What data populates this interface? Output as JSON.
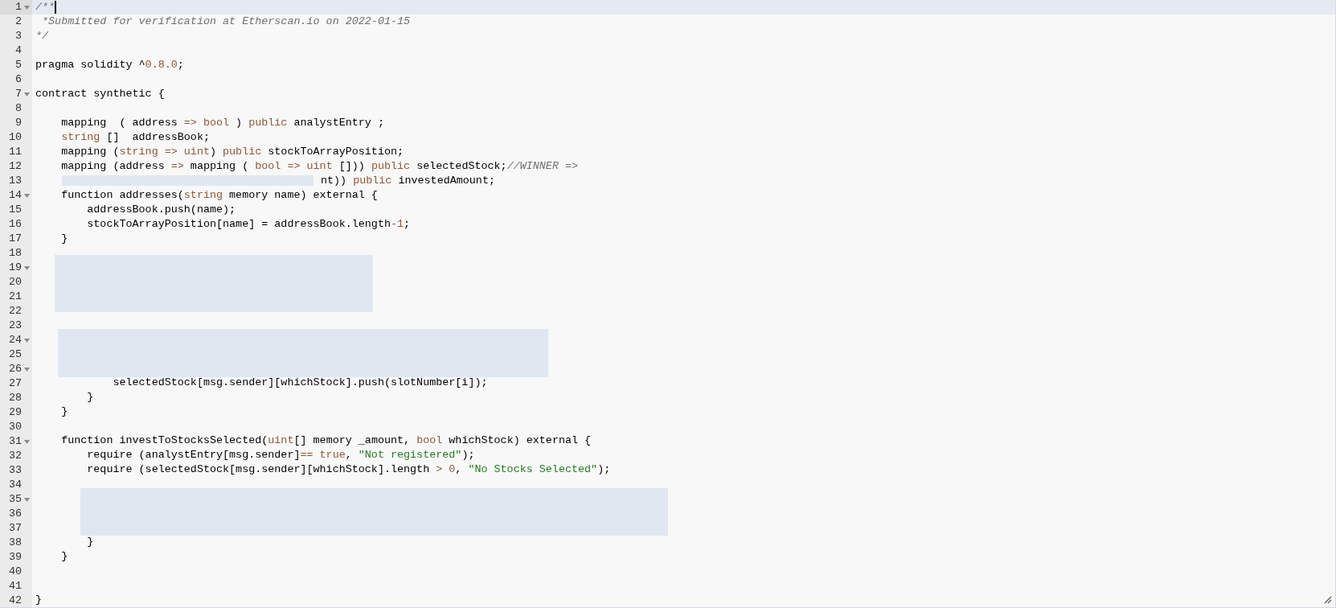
{
  "editor": {
    "lines": [
      {
        "number": "1",
        "kind": "code",
        "fold": true,
        "selected": true,
        "tokens": [
          {
            "kind": "comment",
            "text": "/**"
          }
        ]
      },
      {
        "number": "2",
        "kind": "code",
        "fold": false,
        "selected": false,
        "tokens": [
          {
            "kind": "comment",
            "text": " *Submitted for verification at Etherscan.io on 2022-01-15"
          }
        ]
      },
      {
        "number": "3",
        "kind": "code",
        "fold": false,
        "selected": false,
        "tokens": [
          {
            "kind": "comment",
            "text": "*/"
          }
        ]
      },
      {
        "number": "4",
        "kind": "code",
        "fold": false,
        "selected": false
      },
      {
        "number": "5",
        "kind": "code",
        "fold": false,
        "selected": false,
        "tokens": [
          {
            "kind": "plain",
            "text": "pragma solidity ^"
          },
          {
            "kind": "number",
            "text": "0.8.0"
          },
          {
            "kind": "plain",
            "text": ";"
          }
        ]
      },
      {
        "number": "6",
        "kind": "code",
        "fold": false,
        "selected": false
      },
      {
        "number": "7",
        "kind": "code",
        "fold": true,
        "selected": false,
        "tokens": [
          {
            "kind": "plain",
            "text": "contract synthetic {"
          }
        ]
      },
      {
        "number": "8",
        "kind": "code",
        "fold": false,
        "selected": false
      },
      {
        "number": "9",
        "kind": "code",
        "fold": false,
        "selected": false,
        "tokens": [
          {
            "kind": "plain",
            "text": "    mapping  ( address "
          },
          {
            "kind": "keyword",
            "text": "=> bool"
          },
          {
            "kind": "plain",
            "text": " ) "
          },
          {
            "kind": "keyword",
            "text": "public"
          },
          {
            "kind": "plain",
            "text": " analystEntry ;"
          }
        ]
      },
      {
        "number": "10",
        "kind": "code",
        "fold": false,
        "selected": false,
        "tokens": [
          {
            "kind": "keyword",
            "text": "    string"
          },
          {
            "kind": "plain",
            "text": " []  addressBook;"
          }
        ]
      },
      {
        "number": "11",
        "kind": "code",
        "fold": false,
        "selected": false,
        "tokens": [
          {
            "kind": "plain",
            "text": "    mapping ("
          },
          {
            "kind": "keyword",
            "text": "string => uint"
          },
          {
            "kind": "plain",
            "text": ") "
          },
          {
            "kind": "keyword",
            "text": "public"
          },
          {
            "kind": "plain",
            "text": " stockToArrayPosition;"
          }
        ]
      },
      {
        "number": "12",
        "kind": "code",
        "fold": false,
        "selected": false,
        "tokens": [
          {
            "kind": "plain",
            "text": "    mapping (address "
          },
          {
            "kind": "keyword",
            "text": "=>"
          },
          {
            "kind": "plain",
            "text": " mapping ( "
          },
          {
            "kind": "keyword",
            "text": "bool => uint"
          },
          {
            "kind": "plain",
            "text": " [])) "
          },
          {
            "kind": "keyword",
            "text": "public"
          },
          {
            "kind": "plain",
            "text": " selectedStock;"
          },
          {
            "kind": "comment",
            "text": "//WINNER =>"
          }
        ]
      },
      {
        "number": "13",
        "kind": "covered",
        "fold": false,
        "selected": false,
        "tokens": [
          {
            "kind": "plain",
            "text": "nt)) "
          },
          {
            "kind": "keyword",
            "text": "public"
          },
          {
            "kind": "plain",
            "text": " investedAmount;"
          }
        ]
      },
      {
        "number": "14",
        "kind": "code",
        "fold": true,
        "selected": false,
        "tokens": [
          {
            "kind": "plain",
            "text": "    function addresses("
          },
          {
            "kind": "keyword",
            "text": "string"
          },
          {
            "kind": "plain",
            "text": " memory name) external {"
          }
        ]
      },
      {
        "number": "15",
        "kind": "code",
        "fold": false,
        "selected": false,
        "tokens": [
          {
            "kind": "plain",
            "text": "        addressBook.push(name);"
          }
        ]
      },
      {
        "number": "16",
        "kind": "code",
        "fold": false,
        "selected": false,
        "tokens": [
          {
            "kind": "plain",
            "text": "        stockToArrayPosition[name] = addressBook.length"
          },
          {
            "kind": "keyword",
            "text": "-"
          },
          {
            "kind": "number",
            "text": "1"
          },
          {
            "kind": "plain",
            "text": ";"
          }
        ]
      },
      {
        "number": "17",
        "kind": "code",
        "fold": false,
        "selected": false,
        "tokens": [
          {
            "kind": "plain",
            "text": "    }"
          }
        ]
      },
      {
        "number": "18",
        "kind": "code",
        "fold": false,
        "selected": false
      },
      {
        "number": "19",
        "kind": "code",
        "fold": true,
        "selected": false
      },
      {
        "number": "20",
        "kind": "code",
        "fold": false,
        "selected": false
      },
      {
        "number": "21",
        "kind": "code",
        "fold": false,
        "selected": false
      },
      {
        "number": "22",
        "kind": "code",
        "fold": false,
        "selected": false
      },
      {
        "number": "23",
        "kind": "code",
        "fold": false,
        "selected": false
      },
      {
        "number": "24",
        "kind": "code",
        "fold": true,
        "selected": false
      },
      {
        "number": "25",
        "kind": "code",
        "fold": false,
        "selected": false
      },
      {
        "number": "26",
        "kind": "code",
        "fold": true,
        "selected": false
      },
      {
        "number": "27",
        "kind": "code",
        "fold": false,
        "selected": false,
        "tokens": [
          {
            "kind": "plain",
            "text": "            selectedStock[msg.sender][whichStock].push(slotNumber[i]);"
          }
        ]
      },
      {
        "number": "28",
        "kind": "code",
        "fold": false,
        "selected": false,
        "tokens": [
          {
            "kind": "plain",
            "text": "        }"
          }
        ]
      },
      {
        "number": "29",
        "kind": "code",
        "fold": false,
        "selected": false,
        "tokens": [
          {
            "kind": "plain",
            "text": "    }"
          }
        ]
      },
      {
        "number": "30",
        "kind": "code",
        "fold": false,
        "selected": false
      },
      {
        "number": "31",
        "kind": "code",
        "fold": true,
        "selected": false,
        "tokens": [
          {
            "kind": "plain",
            "text": "    function investToStocksSelected("
          },
          {
            "kind": "keyword",
            "text": "uint"
          },
          {
            "kind": "plain",
            "text": "[] memory _amount, "
          },
          {
            "kind": "keyword",
            "text": "bool"
          },
          {
            "kind": "plain",
            "text": " whichStock) external {"
          }
        ]
      },
      {
        "number": "32",
        "kind": "code",
        "fold": false,
        "selected": false,
        "tokens": [
          {
            "kind": "plain",
            "text": "        require (analystEntry[msg.sender]"
          },
          {
            "kind": "keyword",
            "text": "== true"
          },
          {
            "kind": "plain",
            "text": ", "
          },
          {
            "kind": "string",
            "text": "\"Not registered\""
          },
          {
            "kind": "plain",
            "text": ");"
          }
        ]
      },
      {
        "number": "33",
        "kind": "code",
        "fold": false,
        "selected": false,
        "tokens": [
          {
            "kind": "plain",
            "text": "        require (selectedStock[msg.sender][whichStock].length "
          },
          {
            "kind": "keyword",
            "text": "> 0"
          },
          {
            "kind": "plain",
            "text": ", "
          },
          {
            "kind": "string",
            "text": "\"No Stocks Selected\""
          },
          {
            "kind": "plain",
            "text": ");"
          }
        ]
      },
      {
        "number": "34",
        "kind": "code",
        "fold": false,
        "selected": false
      },
      {
        "number": "35",
        "kind": "code",
        "fold": true,
        "selected": false
      },
      {
        "number": "36",
        "kind": "code",
        "fold": false,
        "selected": false
      },
      {
        "number": "37",
        "kind": "code",
        "fold": false,
        "selected": false
      },
      {
        "number": "38",
        "kind": "code",
        "fold": false,
        "selected": false,
        "tokens": [
          {
            "kind": "plain",
            "text": "        }"
          }
        ]
      },
      {
        "number": "39",
        "kind": "code",
        "fold": false,
        "selected": false,
        "tokens": [
          {
            "kind": "plain",
            "text": "    }"
          }
        ]
      },
      {
        "number": "40",
        "kind": "code",
        "fold": false,
        "selected": false
      },
      {
        "number": "41",
        "kind": "code",
        "fold": false,
        "selected": false
      },
      {
        "number": "42",
        "kind": "code",
        "fold": false,
        "selected": false,
        "tokens": [
          {
            "kind": "plain",
            "text": "}"
          }
        ]
      }
    ]
  }
}
